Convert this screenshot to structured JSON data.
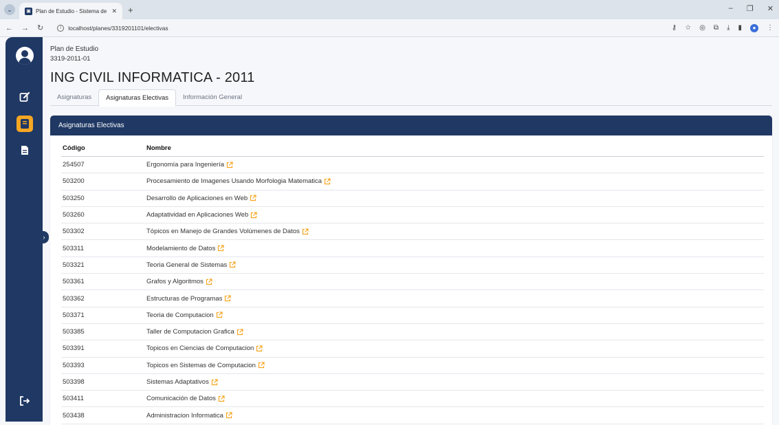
{
  "browser": {
    "tab_title": "Plan de Estudio - Sistema de G",
    "url": "localhost/planes/3319201101/electivas"
  },
  "colors": {
    "sidebar": "#1f3864",
    "accent": "#f5a623",
    "header": "#1f3864"
  },
  "sidebar": {
    "items": [
      {
        "icon": "user-avatar-icon"
      },
      {
        "icon": "edit-icon"
      },
      {
        "icon": "book-icon",
        "active": true
      },
      {
        "icon": "document-icon"
      },
      {
        "icon": "logout-icon"
      }
    ]
  },
  "page": {
    "plan_label": "Plan de Estudio",
    "plan_code": "3319-2011-01",
    "title": "ING CIVIL INFORMATICA - 2011"
  },
  "tabs": [
    {
      "label": "Asignaturas",
      "active": false
    },
    {
      "label": "Asignaturas Electivas",
      "active": true
    },
    {
      "label": "Información General",
      "active": false
    }
  ],
  "card": {
    "header": "Asignaturas Electivas",
    "columns": {
      "code": "Código",
      "name": "Nombre"
    },
    "rows": [
      {
        "code": "254507",
        "name": "Ergonomía para Ingeniería"
      },
      {
        "code": "503200",
        "name": "Procesamiento de Imagenes Usando Morfologia Matematica"
      },
      {
        "code": "503250",
        "name": "Desarrollo de Aplicaciones en Web"
      },
      {
        "code": "503260",
        "name": "Adaptatividad en Aplicaciones Web"
      },
      {
        "code": "503302",
        "name": "Tópicos en Manejo de Grandes Volúmenes de Datos"
      },
      {
        "code": "503311",
        "name": "Modelamiento de Datos"
      },
      {
        "code": "503321",
        "name": "Teoria General de Sistemas"
      },
      {
        "code": "503361",
        "name": "Grafos y Algoritmos"
      },
      {
        "code": "503362",
        "name": "Estructuras de Programas"
      },
      {
        "code": "503371",
        "name": "Teoria de Computacion"
      },
      {
        "code": "503385",
        "name": "Taller de Computacion Grafica"
      },
      {
        "code": "503391",
        "name": "Topicos en Ciencias de Computacion"
      },
      {
        "code": "503393",
        "name": "Topicos en Sistemas de Computacion"
      },
      {
        "code": "503398",
        "name": "Sistemas Adaptativos"
      },
      {
        "code": "503411",
        "name": "Comunicación de Datos"
      },
      {
        "code": "503438",
        "name": "Administracion Informatica"
      }
    ]
  }
}
